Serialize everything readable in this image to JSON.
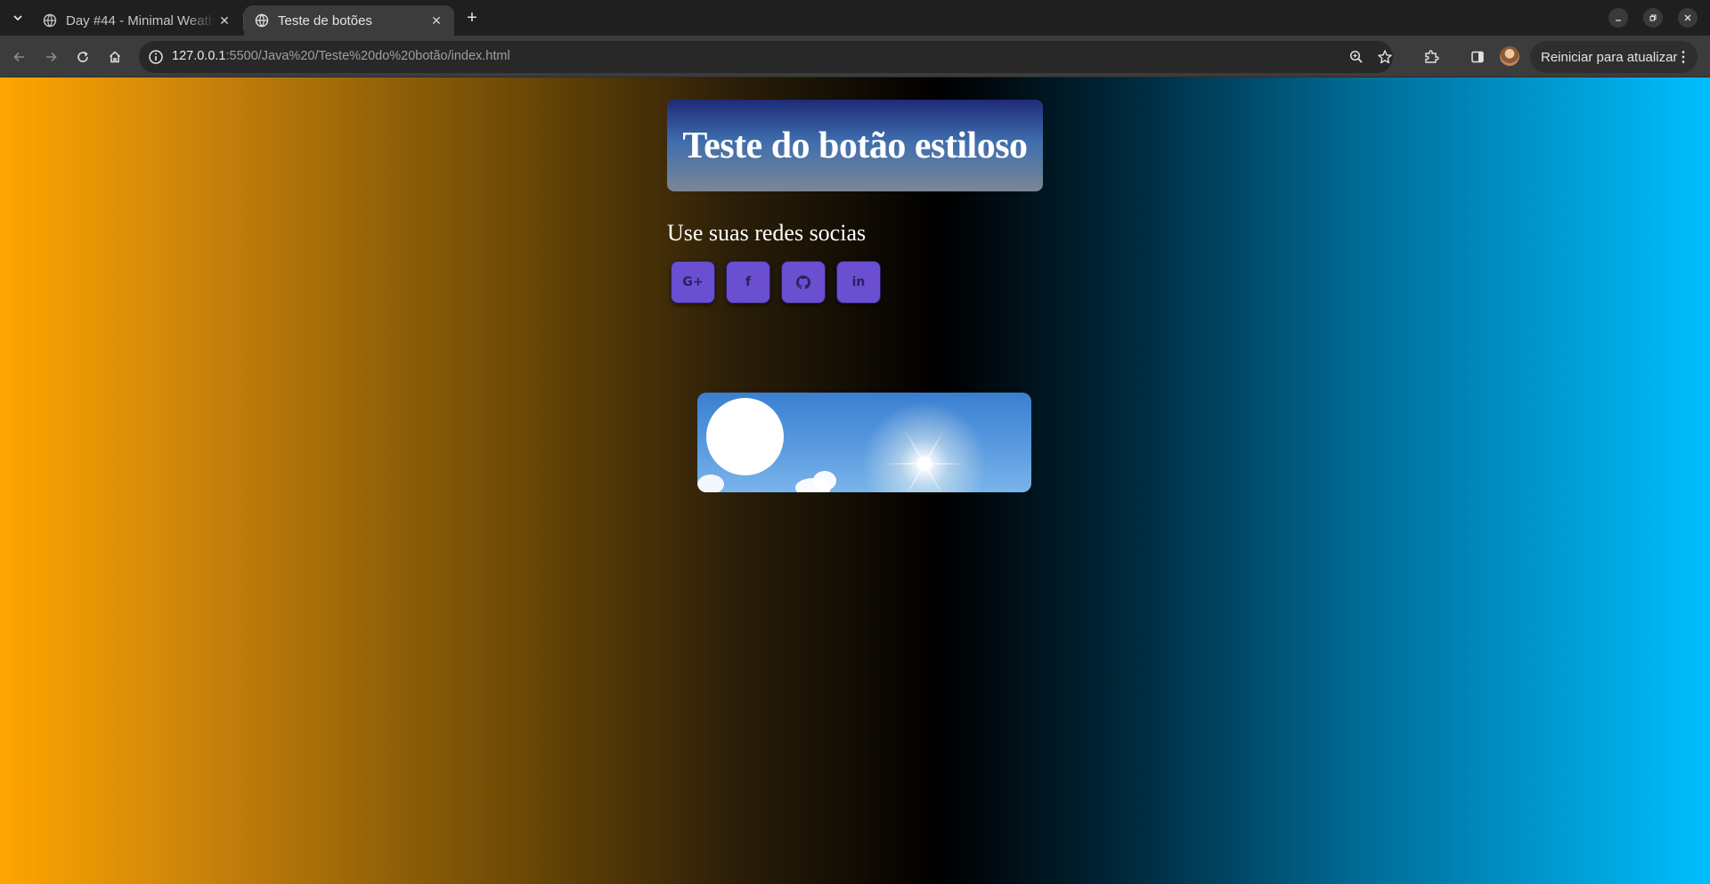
{
  "browser": {
    "tabs": [
      {
        "title": "Day #44 - Minimal Weath",
        "active": false
      },
      {
        "title": "Teste de botões",
        "active": true
      }
    ],
    "address": {
      "host": "127.0.0.1",
      "path": ":5500/Java%20/Teste%20do%20botão/index.html"
    },
    "update_button_label": "Reiniciar para atualizar",
    "icons": {
      "tab_search": "chevron-down-icon",
      "favicon": "globe-icon",
      "tab_close": "close-icon",
      "new_tab": "plus-icon",
      "back": "arrow-left-icon",
      "forward": "arrow-right-icon",
      "reload": "reload-icon",
      "home": "home-icon",
      "site_info": "info-icon",
      "zoom": "zoom-icon",
      "bookmark": "star-icon",
      "extensions": "puzzle-icon",
      "side_panel": "side-panel-icon",
      "menu": "kebab-menu-icon",
      "minimize": "minimize-icon",
      "maximize": "restore-icon",
      "close_window": "close-icon"
    }
  },
  "page": {
    "title": "Teste do botão estiloso",
    "subtitle": "Use suas redes socias",
    "social_buttons": [
      {
        "name": "google-plus",
        "label": "G+"
      },
      {
        "name": "facebook",
        "label": "f"
      },
      {
        "name": "github",
        "label": ""
      },
      {
        "name": "linkedin",
        "label": "in"
      }
    ],
    "colors": {
      "background_gradient": [
        "#ffa500",
        "#000000",
        "#00bfff"
      ],
      "social_button": "#6a4fd0",
      "title_box_gradient": [
        "#1f2a78",
        "#7b8794"
      ]
    }
  }
}
